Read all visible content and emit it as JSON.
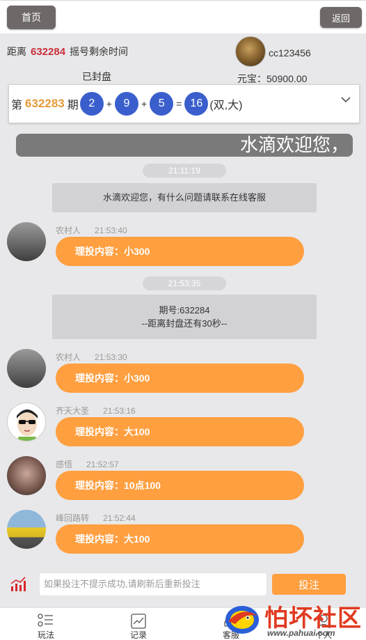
{
  "header": {
    "home_label": "首页",
    "back_label": "返回"
  },
  "draw_info": {
    "countdown_prefix": "距离",
    "countdown_period": "632284",
    "countdown_suffix": "摇号剩余时间",
    "status": "已封盘",
    "username": "cc123456",
    "balance": "元宝：50900.00"
  },
  "last_result": {
    "prefix": "第",
    "period": "632283",
    "suffix": "期",
    "balls": [
      "2",
      "9",
      "5"
    ],
    "operators": [
      "+",
      "+",
      "="
    ],
    "sum": "16",
    "tag": "(双,大)",
    "colors": {
      "ball": "#3a5fcd",
      "period": "#e59a3a"
    }
  },
  "marquee": "水滴欢迎您，",
  "chat": {
    "time_pills": [
      "21:11:19",
      "21:53:35"
    ],
    "system_messages": [
      {
        "lines": [
          "水滴欢迎您，有什么问题请联系在线客服"
        ]
      },
      {
        "lines": [
          "期号:632284",
          "--距离封盘还有30秒--"
        ]
      }
    ],
    "messages": [
      {
        "name": "农村人",
        "time": "21:53:40",
        "content": "理投内容：小300",
        "avatar": "gray-landscape-avatar"
      },
      {
        "name": "农村人",
        "time": "21:53:30",
        "content": "理投内容：小300",
        "avatar": "gray-landscape-avatar"
      },
      {
        "name": "齐天大圣",
        "time": "21:53:16",
        "content": "理投内容：大100",
        "avatar": "cartoon-avatar"
      },
      {
        "name": "感悟",
        "time": "21:52:57",
        "content": "理投内容：10点100",
        "avatar": "woman-avatar"
      },
      {
        "name": "峰回路转",
        "time": "21:52:44",
        "content": "理投内容：大100",
        "avatar": "car-avatar"
      }
    ],
    "bubble_color": "#ff9f40"
  },
  "input_bar": {
    "placeholder": "如果投注不提示成功,请刷新后重新投注",
    "submit_label": "投注"
  },
  "tabs": [
    {
      "label": "玩法",
      "icon": "list-icon"
    },
    {
      "label": "记录",
      "icon": "chart-record-icon"
    },
    {
      "label": "客服",
      "icon": "service-icon"
    },
    {
      "label": "个人",
      "icon": "user-icon"
    }
  ],
  "watermark": {
    "title": "怕坏社区",
    "url": "www.pahuai.com"
  }
}
